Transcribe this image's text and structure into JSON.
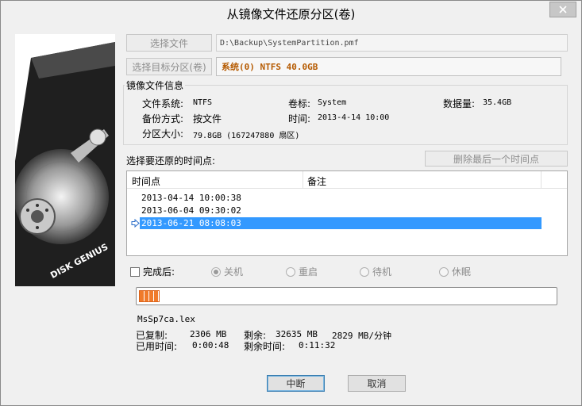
{
  "window": {
    "title": "从镜像文件还原分区(卷)"
  },
  "art": {
    "brand_text": "DISK GENIUS"
  },
  "source": {
    "button_label": "选择文件",
    "path": "D:\\Backup\\SystemPartition.pmf"
  },
  "target": {
    "button_label": "选择目标分区(卷)",
    "value": "系统(0) NTFS 40.0GB"
  },
  "image_info": {
    "legend": "镜像文件信息",
    "fs_label": "文件系统:",
    "fs_value": "NTFS",
    "volume_label": "卷标:",
    "volume_value": "System",
    "data_label": "数据量:",
    "data_value": "35.4GB",
    "backup_label": "备份方式:",
    "backup_value": "按文件",
    "time_label": "时间:",
    "time_value": "2013-4-14 10:00",
    "size_label": "分区大小:",
    "size_value": "79.8GB   (167247880 扇区)"
  },
  "restore_points": {
    "label": "选择要还原的时间点:",
    "delete_button": "删除最后一个时间点",
    "col_time": "时间点",
    "col_note": "备注",
    "rows": [
      {
        "time": "2013-04-14 10:00:38",
        "note": ""
      },
      {
        "time": "2013-06-04 09:30:02",
        "note": ""
      },
      {
        "time": "2013-06-21 08:08:03",
        "note": ""
      }
    ],
    "selected_index": 2
  },
  "after": {
    "checkbox_label": "完成后:",
    "options": [
      "关机",
      "重启",
      "待机",
      "休眠"
    ],
    "selected": "关机"
  },
  "progress": {
    "fraction": 0.05,
    "current_file": "MsSp7ca.lex",
    "copied_label": "已复制:",
    "copied_value": "2306 MB",
    "remaining_label": "剩余:",
    "remaining_value": "32635 MB",
    "speed_value": "2829 MB/分钟",
    "elapsed_label": "已用时间:",
    "elapsed_value": "0:00:48",
    "time_left_label": "剩余时间:",
    "time_left_value": "0:11:32"
  },
  "buttons": {
    "abort": "中断",
    "cancel": "取消"
  },
  "colors": {
    "accent": "#3399ff",
    "target_text": "#b55a00",
    "progress": "#f07a2a"
  }
}
